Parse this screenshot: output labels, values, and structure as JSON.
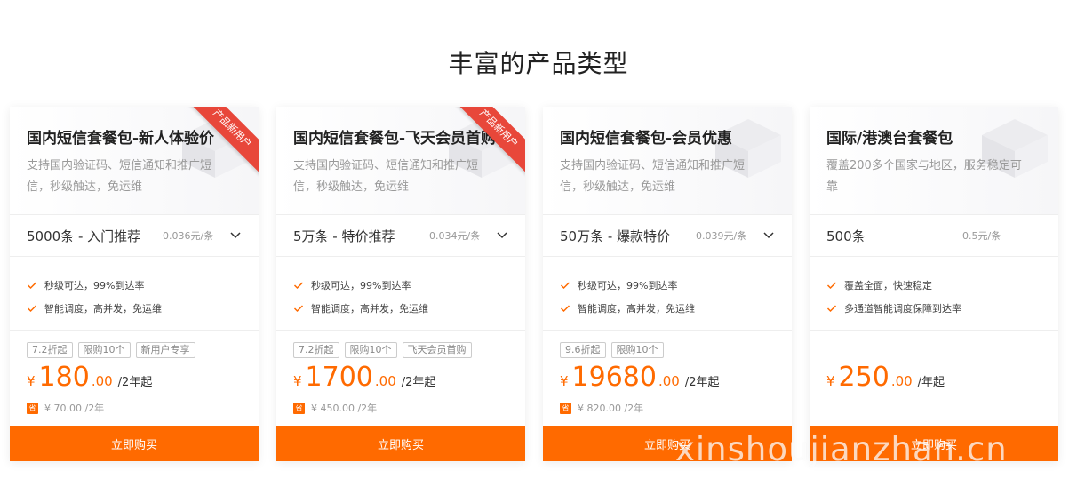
{
  "section": {
    "title": "丰富的产品类型"
  },
  "colors": {
    "accent": "#ff6a00",
    "ribbon": "#e8473a"
  },
  "cards": [
    {
      "title": "国内短信套餐包-新人体验价",
      "ribbon": "产品新用户",
      "description": "支持国内验证码、短信通知和推广短信，秒级触达，免运维",
      "spec": {
        "name": "5000条 - 入门推荐",
        "unit_price": "0.036元/条",
        "dropdown_icon": "chevron-down-icon"
      },
      "features": [
        "秒级可达，99%到达率",
        "智能调度，高并发，免运维"
      ],
      "tags": [
        "7.2折起",
        "限购10个",
        "新用户专享"
      ],
      "price": {
        "currency": "¥",
        "integer": "180",
        "decimal": ".00",
        "unit": "/2年起"
      },
      "original": {
        "badge": "省",
        "text": "¥ 70.00 /2年"
      },
      "buy_label": "立即购买"
    },
    {
      "title": "国内短信套餐包-飞天会员首购",
      "ribbon": "产品新用户",
      "description": "支持国内验证码、短信通知和推广短信，秒级触达，免运维",
      "spec": {
        "name": "5万条 - 特价推荐",
        "unit_price": "0.034元/条",
        "dropdown_icon": "chevron-down-icon"
      },
      "features": [
        "秒级可达，99%到达率",
        "智能调度，高并发，免运维"
      ],
      "tags": [
        "7.2折起",
        "限购10个",
        "飞天会员首购"
      ],
      "price": {
        "currency": "¥",
        "integer": "1700",
        "decimal": ".00",
        "unit": "/2年起"
      },
      "original": {
        "badge": "省",
        "text": "¥ 450.00 /2年"
      },
      "buy_label": "立即购买"
    },
    {
      "title": "国内短信套餐包-会员优惠",
      "ribbon": "",
      "description": "支持国内验证码、短信通知和推广短信，秒级触达，免运维",
      "spec": {
        "name": "50万条 - 爆款特价",
        "unit_price": "0.039元/条",
        "dropdown_icon": "chevron-down-icon"
      },
      "features": [
        "秒级可达，99%到达率",
        "智能调度，高并发，免运维"
      ],
      "tags": [
        "9.6折起",
        "限购10个"
      ],
      "price": {
        "currency": "¥",
        "integer": "19680",
        "decimal": ".00",
        "unit": "/2年起"
      },
      "original": {
        "badge": "省",
        "text": "¥ 820.00 /2年"
      },
      "buy_label": "立即购买"
    },
    {
      "title": "国际/港澳台套餐包",
      "ribbon": "",
      "description": "覆盖200多个国家与地区，服务稳定可靠",
      "spec": {
        "name": "500条",
        "unit_price": "0.5元/条",
        "dropdown_icon": ""
      },
      "features": [
        "覆盖全面，快速稳定",
        "多通道智能调度保障到达率"
      ],
      "tags": [],
      "price": {
        "currency": "¥",
        "integer": "250",
        "decimal": ".00",
        "unit": "/年起"
      },
      "original": {
        "badge": "",
        "text": ""
      },
      "buy_label": "立即购买"
    }
  ],
  "watermark": "xinshoujianzhan.cn"
}
